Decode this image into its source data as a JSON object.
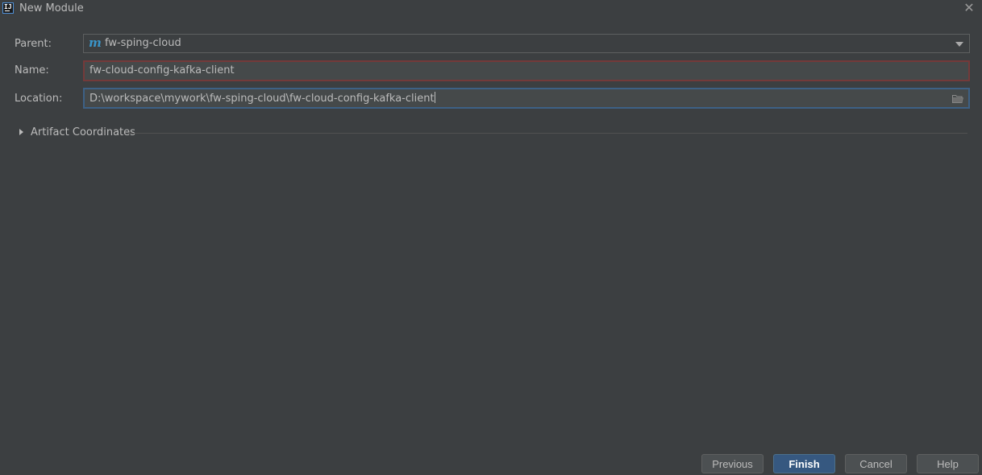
{
  "window": {
    "title": "New Module",
    "app_icon": "intellij-idea-icon",
    "app_icon_text": "IJ"
  },
  "form": {
    "parent": {
      "label": "Parent:",
      "value": "fw-sping-cloud",
      "icon": "maven-module-icon",
      "icon_text": "m"
    },
    "name": {
      "label": "Name:",
      "value": "fw-cloud-config-kafka-client"
    },
    "location": {
      "label": "Location:",
      "value": "D:\\workspace\\mywork\\fw-sping-cloud\\fw-cloud-config-kafka-client"
    }
  },
  "artifact_coordinates": {
    "label": "Artifact Coordinates",
    "expanded": false
  },
  "buttons": {
    "previous": "Previous",
    "finish": "Finish",
    "cancel": "Cancel",
    "help": "Help"
  },
  "colors": {
    "background": "#3c3f41",
    "name_field_error_border": "#743a3a",
    "location_focus_border": "#3d6185",
    "default_button": "#365880",
    "maven_icon": "#3a95c9"
  }
}
